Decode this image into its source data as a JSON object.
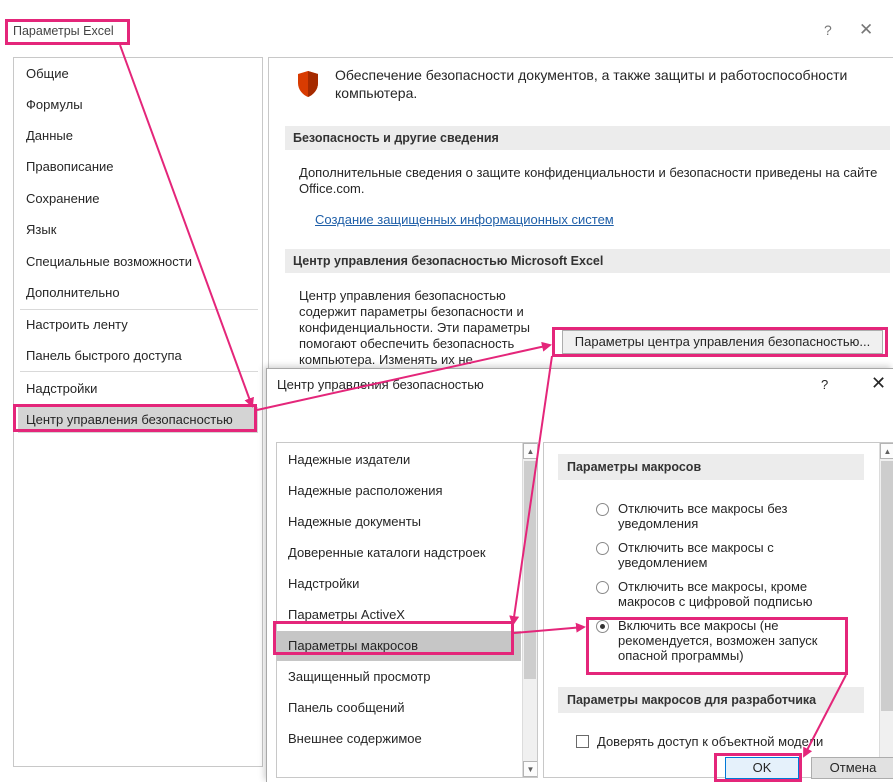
{
  "excel_options": {
    "title": "Параметры Excel",
    "help": "?",
    "close": "✕",
    "nav": [
      "Общие",
      "Формулы",
      "Данные",
      "Правописание",
      "Сохранение",
      "Язык",
      "Специальные возможности",
      "Дополнительно",
      "Настроить ленту",
      "Панель быстрого доступа",
      "Надстройки",
      "Центр управления безопасностью"
    ],
    "selected_nav": "Центр управления безопасностью",
    "content": {
      "heading": "Обеспечение безопасности документов, а также защиты и работоспособности компьютера.",
      "section1_title": "Безопасность и другие сведения",
      "section1_text": "Дополнительные сведения о защите конфиденциальности и безопасности приведены на сайте Office.com.",
      "section1_link": "Создание защищенных информационных систем",
      "section2_title": "Центр управления безопасностью Microsoft Excel",
      "section2_text": "Центр управления безопасностью содержит параметры безопасности и конфиденциальности. Эти параметры помогают обеспечить безопасность компьютера. Изменять их не рекомендуется.",
      "trust_center_button": "Параметры центра управления безопасностью..."
    }
  },
  "trust_center": {
    "title": "Центр управления безопасностью",
    "help": "?",
    "close": "✕",
    "nav": [
      "Надежные издатели",
      "Надежные расположения",
      "Надежные документы",
      "Доверенные каталоги надстроек",
      "Надстройки",
      "Параметры ActiveX",
      "Параметры макросов",
      "Защищенный просмотр",
      "Панель сообщений",
      "Внешнее содержимое"
    ],
    "selected_nav": "Параметры макросов",
    "macro_section_title": "Параметры макросов",
    "macro_options": [
      {
        "label": "Отключить все макросы без уведомления",
        "checked": false
      },
      {
        "label": "Отключить все макросы с уведомлением",
        "checked": false
      },
      {
        "label": "Отключить все макросы, кроме макросов с цифровой подписью",
        "checked": false
      },
      {
        "label": "Включить все макросы (не рекомендуется, возможен запуск опасной программы)",
        "checked": true
      }
    ],
    "dev_section_title": "Параметры макросов для разработчика",
    "vba_trust_checkbox": {
      "label": "Доверять доступ к объектной модели",
      "checked": false
    },
    "ok_label": "OK",
    "cancel_label": "Отмена"
  },
  "colors": {
    "highlight": "#e4267a",
    "link": "#1f5fa8",
    "shield": "#d83b01"
  }
}
